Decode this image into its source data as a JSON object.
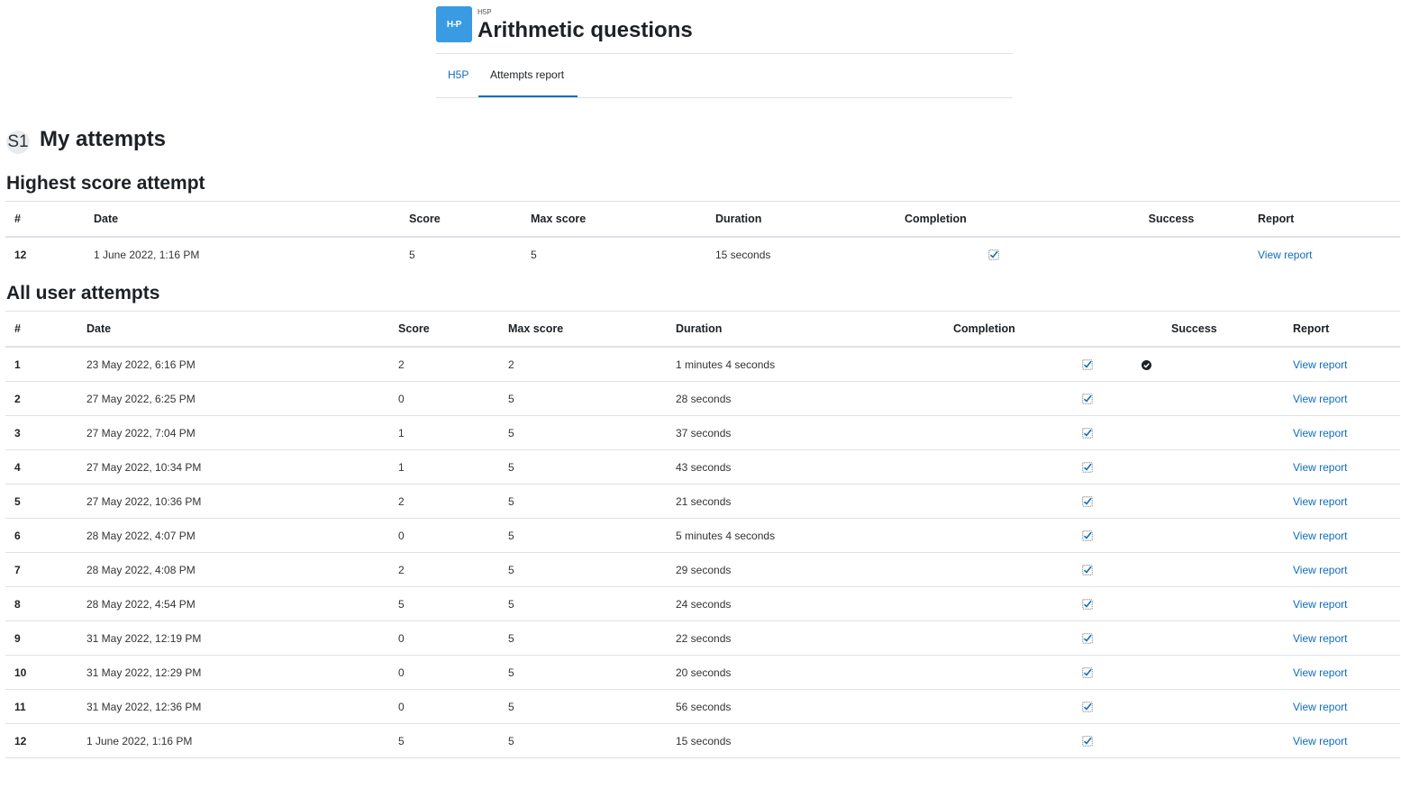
{
  "header": {
    "icon_label": "H-P",
    "activity_type": "H5P",
    "title": "Arithmetic questions",
    "tabs": [
      {
        "label": "H5P"
      },
      {
        "label": "Attempts report"
      }
    ]
  },
  "user": {
    "initials": "S1",
    "heading": "My attempts"
  },
  "highest": {
    "title": "Highest score attempt",
    "columns": [
      "#",
      "Date",
      "Score",
      "Max score",
      "Duration",
      "Completion",
      "Success",
      "Report"
    ],
    "row": {
      "num": "12",
      "date": "1 June 2022, 1:16 PM",
      "score": "5",
      "max": "5",
      "duration": "15 seconds",
      "completion": true,
      "success": false,
      "report": "View report"
    }
  },
  "all": {
    "title": "All user attempts",
    "columns": [
      "#",
      "Date",
      "Score",
      "Max score",
      "Duration",
      "Completion",
      "Success",
      "Report"
    ],
    "rows": [
      {
        "num": "1",
        "date": "23 May 2022, 6:16 PM",
        "score": "2",
        "max": "2",
        "duration": "1 minutes 4 seconds",
        "completion": true,
        "success": true,
        "report": "View report"
      },
      {
        "num": "2",
        "date": "27 May 2022, 6:25 PM",
        "score": "0",
        "max": "5",
        "duration": "28 seconds",
        "completion": true,
        "success": false,
        "report": "View report"
      },
      {
        "num": "3",
        "date": "27 May 2022, 7:04 PM",
        "score": "1",
        "max": "5",
        "duration": "37 seconds",
        "completion": true,
        "success": false,
        "report": "View report"
      },
      {
        "num": "4",
        "date": "27 May 2022, 10:34 PM",
        "score": "1",
        "max": "5",
        "duration": "43 seconds",
        "completion": true,
        "success": false,
        "report": "View report"
      },
      {
        "num": "5",
        "date": "27 May 2022, 10:36 PM",
        "score": "2",
        "max": "5",
        "duration": "21 seconds",
        "completion": true,
        "success": false,
        "report": "View report"
      },
      {
        "num": "6",
        "date": "28 May 2022, 4:07 PM",
        "score": "0",
        "max": "5",
        "duration": "5 minutes 4 seconds",
        "completion": true,
        "success": false,
        "report": "View report"
      },
      {
        "num": "7",
        "date": "28 May 2022, 4:08 PM",
        "score": "2",
        "max": "5",
        "duration": "29 seconds",
        "completion": true,
        "success": false,
        "report": "View report"
      },
      {
        "num": "8",
        "date": "28 May 2022, 4:54 PM",
        "score": "5",
        "max": "5",
        "duration": "24 seconds",
        "completion": true,
        "success": false,
        "report": "View report"
      },
      {
        "num": "9",
        "date": "31 May 2022, 12:19 PM",
        "score": "0",
        "max": "5",
        "duration": "22 seconds",
        "completion": true,
        "success": false,
        "report": "View report"
      },
      {
        "num": "10",
        "date": "31 May 2022, 12:29 PM",
        "score": "0",
        "max": "5",
        "duration": "20 seconds",
        "completion": true,
        "success": false,
        "report": "View report"
      },
      {
        "num": "11",
        "date": "31 May 2022, 12:36 PM",
        "score": "0",
        "max": "5",
        "duration": "56 seconds",
        "completion": true,
        "success": false,
        "report": "View report"
      },
      {
        "num": "12",
        "date": "1 June 2022, 1:16 PM",
        "score": "5",
        "max": "5",
        "duration": "15 seconds",
        "completion": true,
        "success": false,
        "report": "View report"
      }
    ]
  }
}
